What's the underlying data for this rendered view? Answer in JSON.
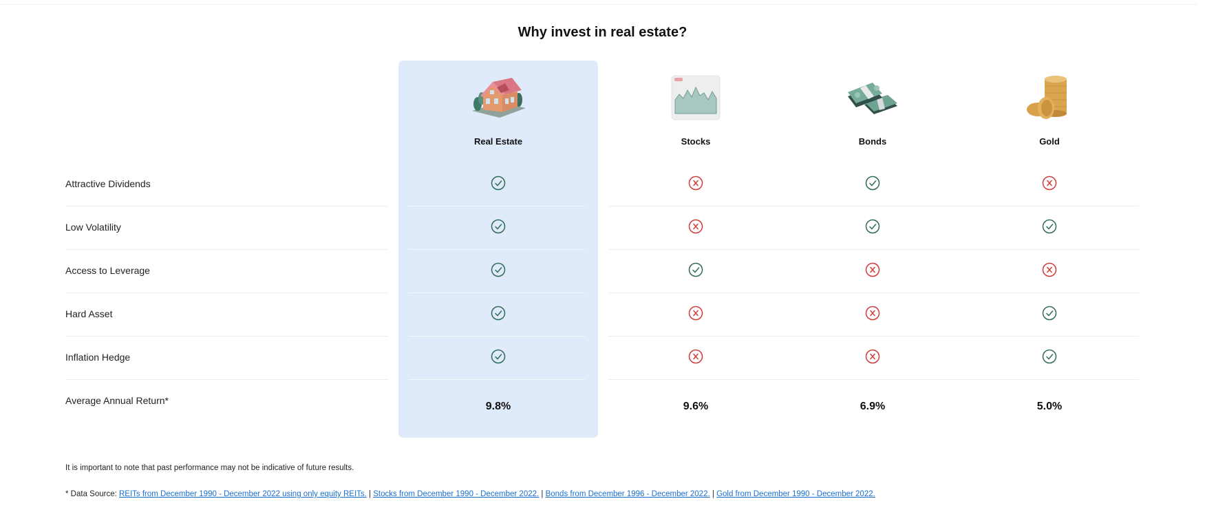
{
  "title": "Why invest in real estate?",
  "accent_color": "#dfeafa",
  "status_colors": {
    "check": "#2e6b57",
    "cross": "#d13b3b"
  },
  "columns": [
    {
      "label": "Real Estate",
      "icon": "house-icon",
      "highlighted": true
    },
    {
      "label": "Stocks",
      "icon": "stock-chart-icon",
      "highlighted": false
    },
    {
      "label": "Bonds",
      "icon": "cash-stack-icon",
      "highlighted": false
    },
    {
      "label": "Gold",
      "icon": "gold-coins-icon",
      "highlighted": false
    }
  ],
  "rows": [
    {
      "label": "Attractive Dividends",
      "values": [
        "check",
        "cross",
        "check",
        "cross"
      ]
    },
    {
      "label": "Low Volatility",
      "values": [
        "check",
        "cross",
        "check",
        "check"
      ]
    },
    {
      "label": "Access to Leverage",
      "values": [
        "check",
        "check",
        "cross",
        "cross"
      ]
    },
    {
      "label": "Hard Asset",
      "values": [
        "check",
        "cross",
        "cross",
        "check"
      ]
    },
    {
      "label": "Inflation Hedge",
      "values": [
        "check",
        "cross",
        "cross",
        "check"
      ]
    }
  ],
  "returns_row": {
    "label": "Average Annual Return*",
    "values": [
      "9.8%",
      "9.6%",
      "6.9%",
      "5.0%"
    ]
  },
  "footer": {
    "disclaimer": "It is important to note that past performance may not be indicative of future results.",
    "sources_prefix": "* Data Source: ",
    "separator": " | ",
    "sources": [
      "REITs from December 1990 - December 2022 using only equity REITs.",
      "Stocks from December 1990 - December 2022.",
      "Bonds from December 1996 - December 2022.",
      "Gold from December 1990 - December 2022."
    ]
  }
}
